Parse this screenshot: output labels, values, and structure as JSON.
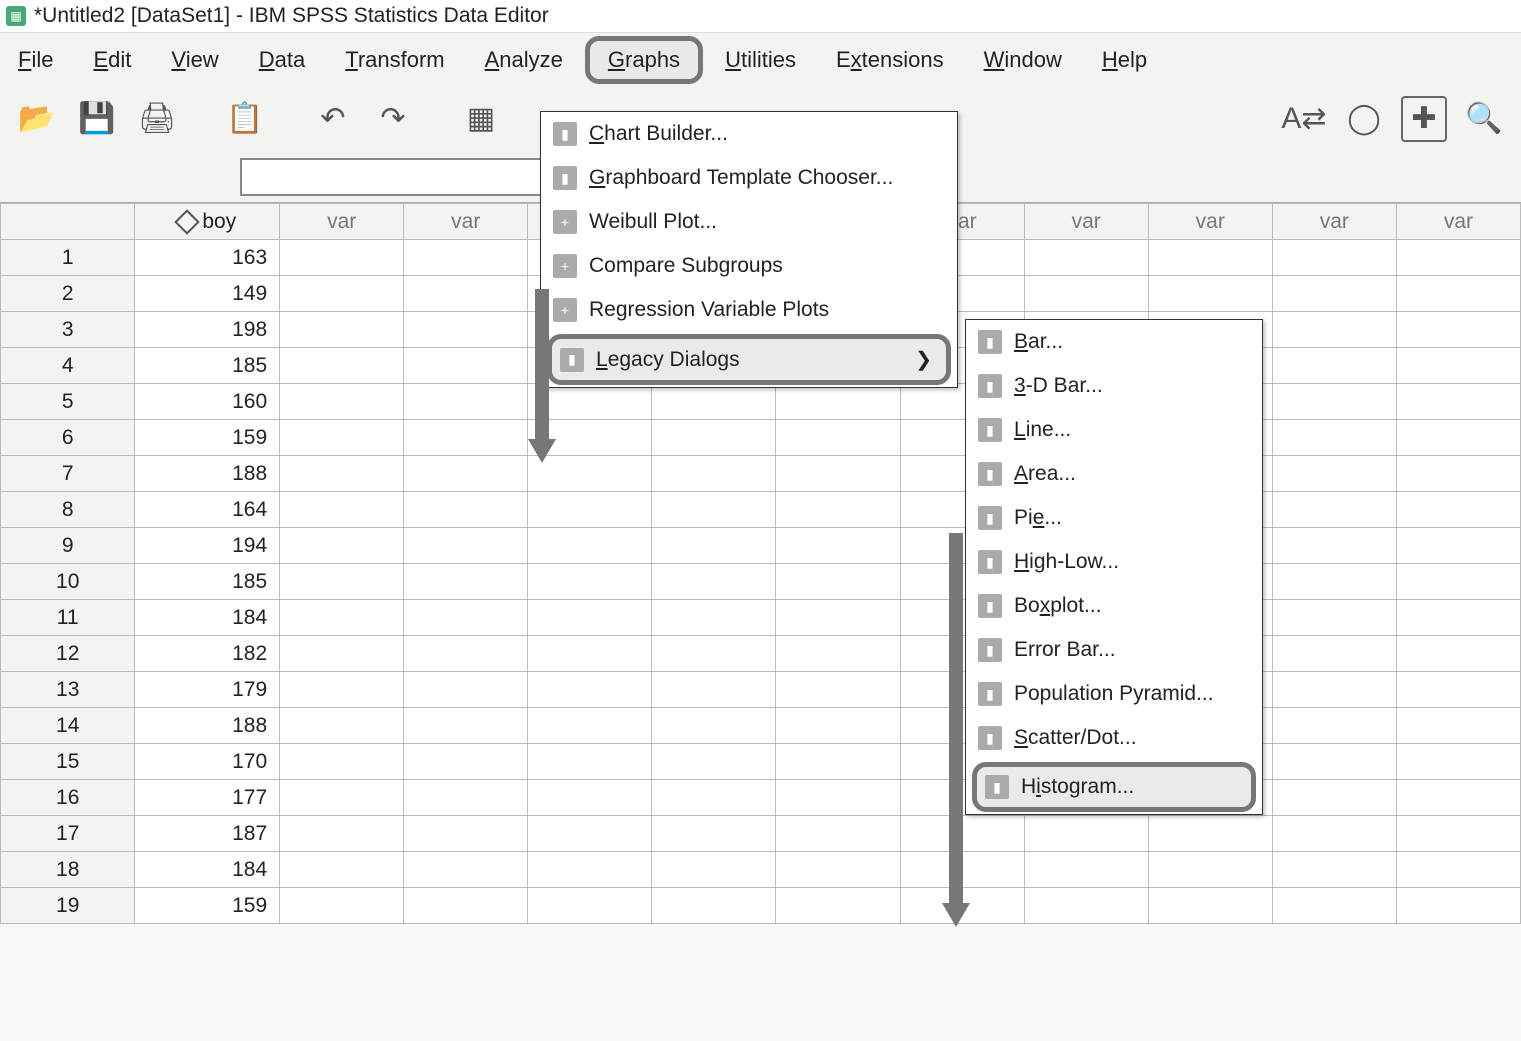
{
  "window": {
    "title": "*Untitled2 [DataSet1] - IBM SPSS Statistics Data Editor"
  },
  "menubar": [
    {
      "label": "File",
      "ul": "F"
    },
    {
      "label": "Edit",
      "ul": "E"
    },
    {
      "label": "View",
      "ul": "V"
    },
    {
      "label": "Data",
      "ul": "D"
    },
    {
      "label": "Transform",
      "ul": "T"
    },
    {
      "label": "Analyze",
      "ul": "A"
    },
    {
      "label": "Graphs",
      "ul": "G",
      "highlighted": true
    },
    {
      "label": "Utilities",
      "ul": "U"
    },
    {
      "label": "Extensions",
      "ul": "x"
    },
    {
      "label": "Window",
      "ul": "W"
    },
    {
      "label": "Help",
      "ul": "H"
    }
  ],
  "graphs_menu": {
    "items": [
      {
        "label": "Chart Builder...",
        "ul": "C",
        "icon": "bar"
      },
      {
        "label": "Graphboard Template Chooser...",
        "ul": "G",
        "icon": "board"
      },
      {
        "label": "Weibull Plot...",
        "icon": "plus"
      },
      {
        "label": "Compare Subgroups",
        "icon": "plus"
      },
      {
        "label": "Regression Variable Plots",
        "icon": "plus"
      },
      {
        "label": "Legacy Dialogs",
        "ul": "L",
        "submenu": true,
        "highlighted": true
      }
    ]
  },
  "legacy_submenu": {
    "items": [
      {
        "label": "Bar...",
        "ul": "B",
        "icon": "bar"
      },
      {
        "label": "3-D Bar...",
        "ul": "3",
        "icon": "bar3d"
      },
      {
        "label": "Line...",
        "ul": "L",
        "icon": "line"
      },
      {
        "label": "Area...",
        "ul": "A",
        "icon": "area"
      },
      {
        "label": "Pie...",
        "ul": "e",
        "icon": "pie"
      },
      {
        "label": "High-Low...",
        "ul": "H",
        "icon": "hilo"
      },
      {
        "label": "Boxplot...",
        "ul": "x",
        "icon": "box"
      },
      {
        "label": "Error Bar...",
        "ul": "O",
        "icon": "err"
      },
      {
        "label": "Population Pyramid...",
        "icon": "pyr"
      },
      {
        "label": "Scatter/Dot...",
        "ul": "S",
        "icon": "scat"
      },
      {
        "label": "Histogram...",
        "ul": "i",
        "icon": "hist",
        "highlighted": true
      }
    ]
  },
  "grid": {
    "columns": [
      "boy",
      "var",
      "var",
      "var",
      "var",
      "var",
      "var",
      "var",
      "var",
      "var",
      "var"
    ],
    "rows": [
      {
        "n": 1,
        "boy": 163
      },
      {
        "n": 2,
        "boy": 149
      },
      {
        "n": 3,
        "boy": 198
      },
      {
        "n": 4,
        "boy": 185
      },
      {
        "n": 5,
        "boy": 160
      },
      {
        "n": 6,
        "boy": 159
      },
      {
        "n": 7,
        "boy": 188
      },
      {
        "n": 8,
        "boy": 164
      },
      {
        "n": 9,
        "boy": 194
      },
      {
        "n": 10,
        "boy": 185
      },
      {
        "n": 11,
        "boy": 184
      },
      {
        "n": 12,
        "boy": 182
      },
      {
        "n": 13,
        "boy": 179
      },
      {
        "n": 14,
        "boy": 188
      },
      {
        "n": 15,
        "boy": 170
      },
      {
        "n": 16,
        "boy": 177
      },
      {
        "n": 17,
        "boy": 187
      },
      {
        "n": 18,
        "boy": 184
      },
      {
        "n": 19,
        "boy": 159
      }
    ]
  }
}
